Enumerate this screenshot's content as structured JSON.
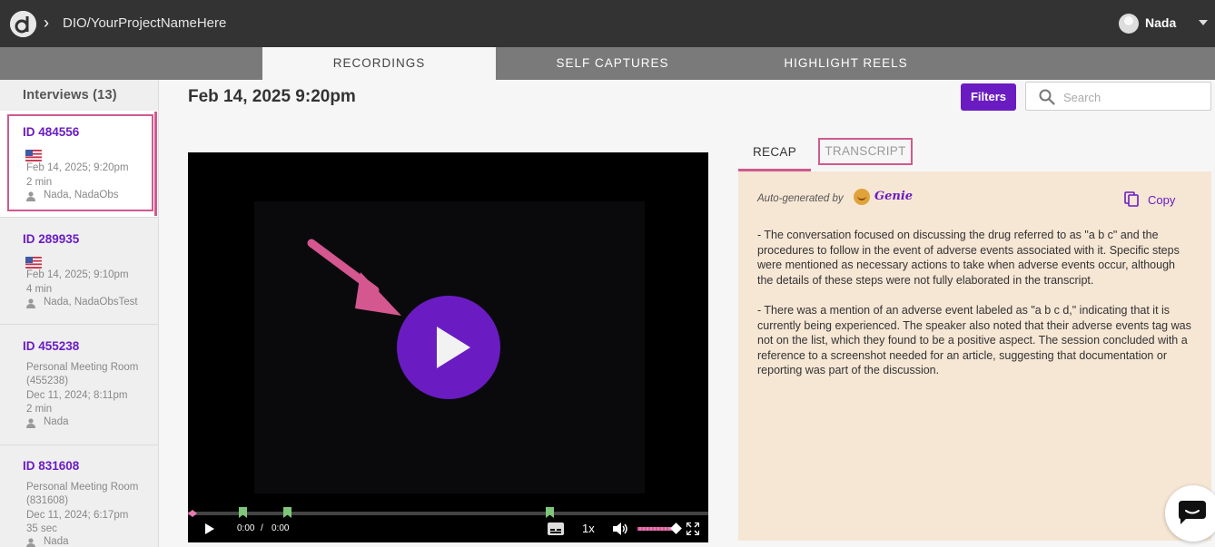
{
  "header": {
    "breadcrumb": "DIO/YourProjectNameHere",
    "user_name": "Nada"
  },
  "tabs": [
    {
      "label": "RECORDINGS",
      "active": true
    },
    {
      "label": "SELF CAPTURES",
      "active": false
    },
    {
      "label": "HIGHLIGHT REELS",
      "active": false
    }
  ],
  "sidebar": {
    "title": "Interviews (13)",
    "interviews": [
      {
        "id": "ID 484556",
        "flag": "us-flag-icon",
        "room": "",
        "date": "Feb 14, 2025; 9:20pm",
        "duration": "2 min",
        "participants": "Nada, NadaObs",
        "selected": true
      },
      {
        "id": "ID 289935",
        "flag": "us-flag-icon",
        "room": "",
        "date": "Feb 14, 2025; 9:10pm",
        "duration": "4 min",
        "participants": "Nada, NadaObsTest",
        "selected": false
      },
      {
        "id": "ID 455238",
        "flag": "",
        "room": "Personal Meeting Room (455238)",
        "date": "Dec 11, 2024; 8:11pm",
        "duration": "2 min",
        "participants": "Nada",
        "selected": false
      },
      {
        "id": "ID 831608",
        "flag": "",
        "room": "Personal Meeting Room (831608)",
        "date": "Dec 11, 2024; 6:17pm",
        "duration": "35 sec",
        "participants": "Nada",
        "selected": false
      }
    ]
  },
  "main": {
    "title": "Feb 14, 2025 9:20pm",
    "filters_label": "Filters",
    "search_placeholder": "Search"
  },
  "player": {
    "current_time": "0:00",
    "separator": "/",
    "duration": "0:00",
    "speed": "1x"
  },
  "recap": {
    "tab_recap": "RECAP",
    "tab_transcript": "TRANSCRIPT",
    "auto_generated_label": "Auto-generated by",
    "genie_label": "Genie",
    "copy_label": "Copy",
    "paragraphs": [
      "- The conversation focused on discussing the drug referred to as \"a b c\" and the procedures to follow in the event of adverse events associated with it. Specific steps were mentioned as necessary actions to take when adverse events occur, although the details of these steps were not fully elaborated in the transcript.",
      "- There was a mention of an adverse event labeled as \"a b c d,\" indicating that it is currently being experienced. The speaker also noted that their adverse events tag was not on the list, which they found to be a positive aspect. The session concluded with a reference to a screenshot needed for an article, suggesting that documentation or reporting was part of the discussion."
    ]
  },
  "colors": {
    "accent_purple": "#6a1cc2",
    "highlight_pink": "#cf5a8e",
    "recap_bg": "#f6e6d4",
    "topbar_bg": "#333333",
    "marker_green": "#7ec77a"
  }
}
